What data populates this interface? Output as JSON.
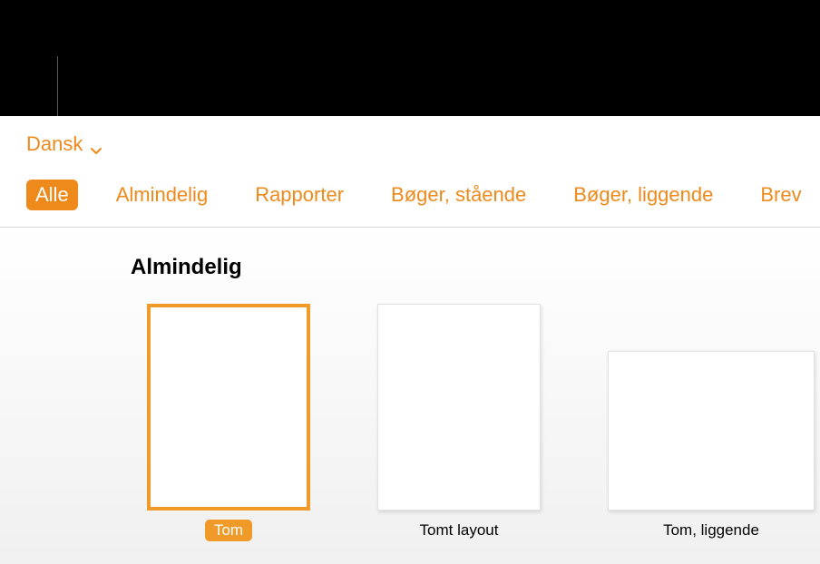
{
  "language": {
    "label": "Dansk"
  },
  "tabs": {
    "items": [
      {
        "label": "Alle"
      },
      {
        "label": "Almindelig"
      },
      {
        "label": "Rapporter"
      },
      {
        "label": "Bøger, stående"
      },
      {
        "label": "Bøger, liggende"
      },
      {
        "label": "Brev"
      }
    ]
  },
  "section": {
    "title": "Almindelig"
  },
  "templates": {
    "items": [
      {
        "label": "Tom"
      },
      {
        "label": "Tomt layout"
      },
      {
        "label": "Tom, liggende"
      }
    ]
  }
}
